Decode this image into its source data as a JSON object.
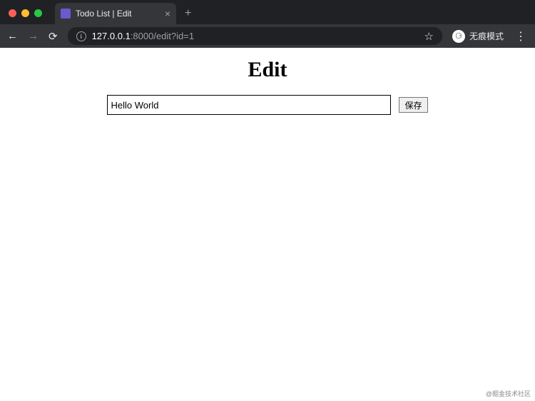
{
  "browser": {
    "tab_title": "Todo List | Edit",
    "new_tab_label": "+",
    "tab_close_label": "×",
    "url_host": "127.0.0.1",
    "url_port_path": ":8000/edit?id=1",
    "incognito_label": "无痕模式",
    "menu_dots": "⋮",
    "back_icon": "←",
    "forward_icon": "→",
    "reload_icon": "⟳",
    "info_icon": "i",
    "star_icon": "☆",
    "incognito_glyph": "⚆"
  },
  "page": {
    "heading": "Edit",
    "input_value": "Hello World",
    "save_label": "保存"
  },
  "watermark": "@掘金技术社区"
}
